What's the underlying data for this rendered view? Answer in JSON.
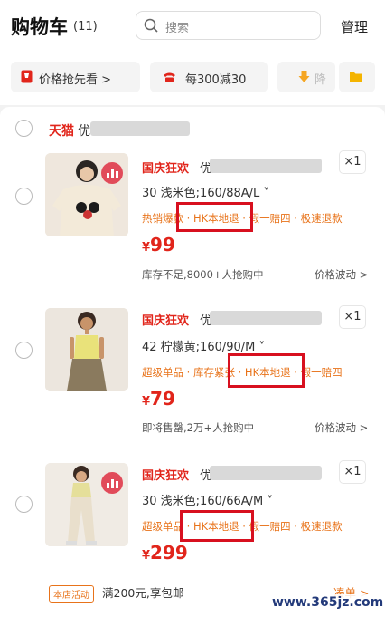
{
  "header": {
    "title": "购物车",
    "count": "(11)",
    "search_placeholder": "搜索",
    "manage": "管理"
  },
  "filters": [
    {
      "label": "价格抢先看 >"
    },
    {
      "label": "每300减30"
    },
    {
      "label": "降"
    }
  ],
  "shop": {
    "name": "天猫",
    "name_tail": "优"
  },
  "items": [
    {
      "promo": "国庆狂欢",
      "title_tail": "优",
      "spec": "30 浅米色;160/88A/L ˅",
      "tags": "热销爆款 · HK本地退 · 假一赔四 · 极速退款",
      "currency": "¥",
      "price": "99",
      "stock": "库存不足,8000+人抢购中",
      "trend": "价格波动 >",
      "qty": "×1"
    },
    {
      "promo": "国庆狂欢",
      "title_tail": "优",
      "spec": "42 柠檬黄;160/90/M ˅",
      "tags": "超级单品 · 库存紧张 · HK本地退 · 假一赔四",
      "currency": "¥",
      "price": "79",
      "stock": "即将售罄,2万+人抢购中",
      "trend": "价格波动 >",
      "qty": "×1"
    },
    {
      "promo": "国庆狂欢",
      "title_tail": "优",
      "spec": "30 浅米色;160/66A/M ˅",
      "tags": "超级单品 · HK本地退 · 假一赔四 · 极速退款",
      "currency": "¥",
      "price": "299",
      "stock": "",
      "trend": "",
      "qty": "×1"
    }
  ],
  "footer": {
    "tag": "本店活动",
    "text": "满200元,享包邮",
    "link": "凑单 >"
  },
  "watermark": "www.365jz.com",
  "colors": {
    "accent_red": "#e1251b",
    "tag_orange": "#e8731a",
    "highlight_box": "#d8101f"
  },
  "icons": [
    "search-icon",
    "price-tag-icon",
    "phone-icon",
    "down-arrow-icon",
    "folder-icon",
    "chart-badge-icon"
  ]
}
